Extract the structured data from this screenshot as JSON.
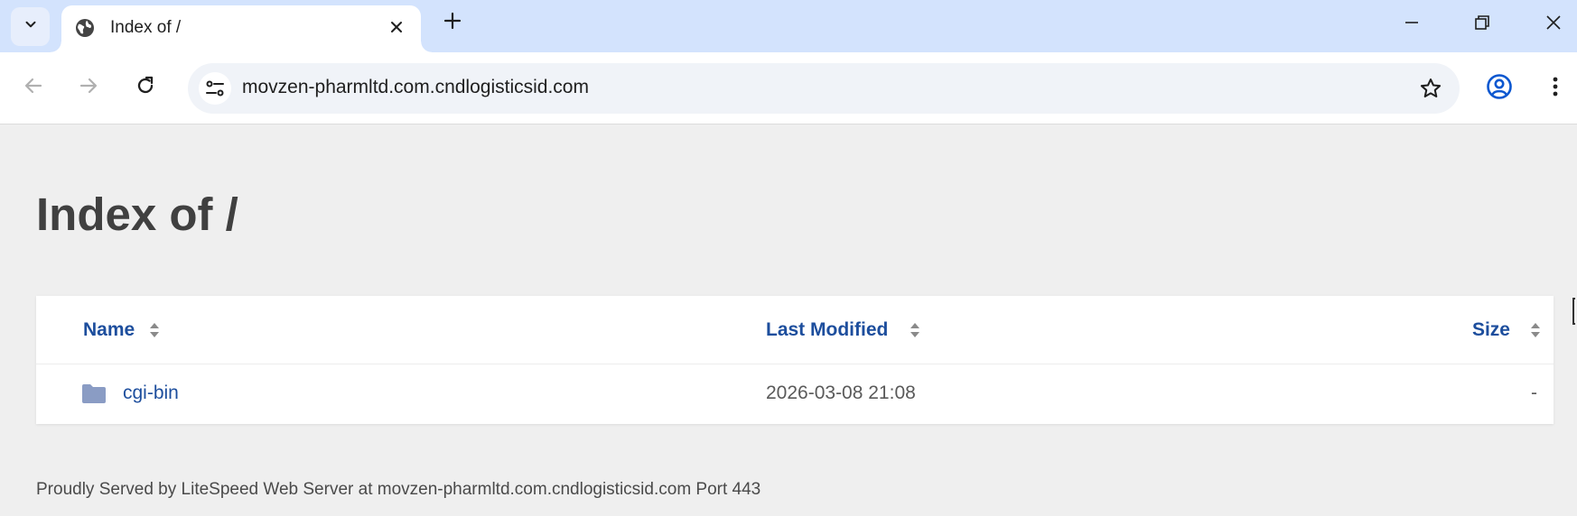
{
  "browser": {
    "tab": {
      "title": "Index of /",
      "favicon": "globe-icon"
    },
    "address_bar": {
      "url": "movzen-pharmltd.com.cndlogisticsid.com"
    },
    "icons": {
      "tab_menu": "chevron-down-icon",
      "close_tab": "close-icon",
      "new_tab": "plus-icon",
      "back": "arrow-left-icon",
      "forward": "arrow-right-icon",
      "reload": "reload-icon",
      "site_info": "tune-icon",
      "bookmark": "star-icon",
      "profile": "profile-icon",
      "menu": "kebab-menu-icon",
      "minimize": "minimize-icon",
      "restore": "restore-icon",
      "close_window": "close-icon"
    }
  },
  "page": {
    "heading": "Index of /",
    "columns": {
      "name": "Name",
      "last_modified": "Last Modified",
      "size": "Size"
    },
    "entries": [
      {
        "name": "cgi-bin",
        "last_modified": "2026-03-08 21:08",
        "size": "-",
        "icon": "folder-icon"
      }
    ],
    "footer": "Proudly Served by LiteSpeed Web Server at movzen-pharmltd.com.cndlogisticsid.com Port 443"
  },
  "colors": {
    "tabstrip_bg": "#d3e3fd",
    "link": "#1d4e9d",
    "page_bg": "#efefef",
    "heading": "#404040",
    "folder_icon": "#8a9cc4"
  }
}
